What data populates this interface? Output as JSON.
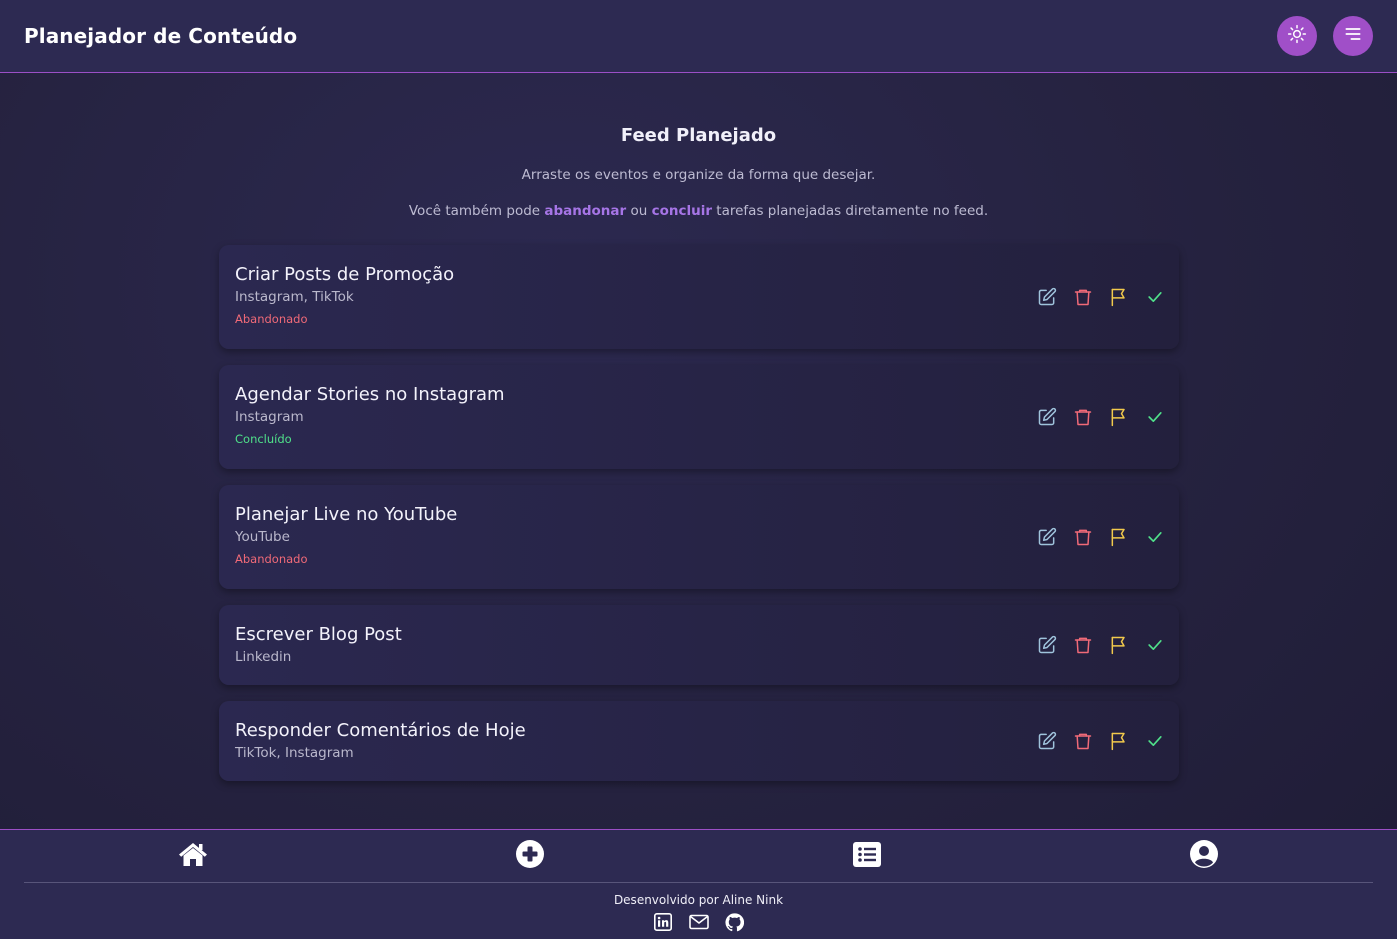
{
  "header": {
    "title": "Planejador de Conteúdo",
    "theme_icon": "sun-icon",
    "menu_icon": "menu-icon"
  },
  "main": {
    "title": "Feed Planejado",
    "subtitle": "Arraste os eventos e organize da forma que desejar.",
    "hint": {
      "before": "Você também pode ",
      "abandon": "abandonar",
      "middle": " ou ",
      "complete": "concluir",
      "after": " tarefas planejadas diretamente no feed."
    }
  },
  "cards": [
    {
      "title": "Criar Posts de Promoção",
      "platforms": "Instagram, TikTok",
      "status": "Abandonado"
    },
    {
      "title": "Agendar Stories no Instagram",
      "platforms": "Instagram",
      "status": "Concluído"
    },
    {
      "title": "Planejar Live no YouTube",
      "platforms": "YouTube",
      "status": "Abandonado"
    },
    {
      "title": "Escrever Blog Post",
      "platforms": "Linkedin",
      "status": ""
    },
    {
      "title": "Responder Comentários de Hoje",
      "platforms": "TikTok, Instagram",
      "status": ""
    }
  ],
  "card_actions": [
    "edit-icon",
    "trash-icon",
    "flag-icon",
    "check-icon"
  ],
  "nav": [
    "home-icon",
    "add-circle-icon",
    "list-icon",
    "user-circle-icon"
  ],
  "footer": {
    "credits": "Desenvolvido por Aline Nink",
    "socials": [
      "linkedin-icon",
      "mail-icon",
      "github-icon"
    ]
  },
  "colors": {
    "accent": "#a04fc8",
    "edit": "#9fc3dc",
    "delete": "#f06a78",
    "flag": "#f2c94c",
    "check": "#4fe08a",
    "abandoned": "#f06a78",
    "done": "#4fe08a"
  }
}
